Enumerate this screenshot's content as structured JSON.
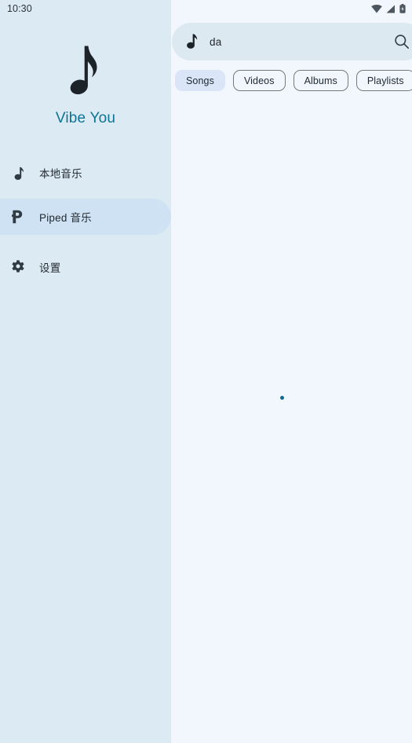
{
  "statusbar": {
    "time": "10:30",
    "icons": [
      {
        "name": "wifi-icon"
      },
      {
        "name": "cellular-signal-icon"
      },
      {
        "name": "battery-icon"
      }
    ]
  },
  "sidebar": {
    "brand": {
      "logo_icon": "music-note-icon",
      "title": "Vibe You",
      "title_color": "#0f7393"
    },
    "items": [
      {
        "label": "本地音乐",
        "icon": "music-note-icon",
        "active": false
      },
      {
        "label": "Piped 音乐",
        "icon": "piped-p-icon",
        "active": true
      },
      {
        "label": "设置",
        "icon": "gear-icon",
        "active": false
      }
    ]
  },
  "search": {
    "leading_icon": "music-note-icon",
    "value": "da",
    "placeholder": "搜索",
    "submit_icon": "search-icon"
  },
  "filters": {
    "chips": [
      {
        "label": "Songs",
        "selected": true
      },
      {
        "label": "Videos",
        "selected": false
      },
      {
        "label": "Albums",
        "selected": false
      },
      {
        "label": "Playlists",
        "selected": false
      }
    ]
  },
  "results": {
    "state": "loading",
    "spinner_color": "#106b91"
  },
  "theme": {
    "sidebar_bg": "#dcebf3",
    "content_bg": "#f2f7fd",
    "active_pill_bg": "#cfe2f3",
    "searchbar_bg": "#dce9f1",
    "chip_selected_bg": "#dae6f8",
    "accent": "#0f7393"
  }
}
